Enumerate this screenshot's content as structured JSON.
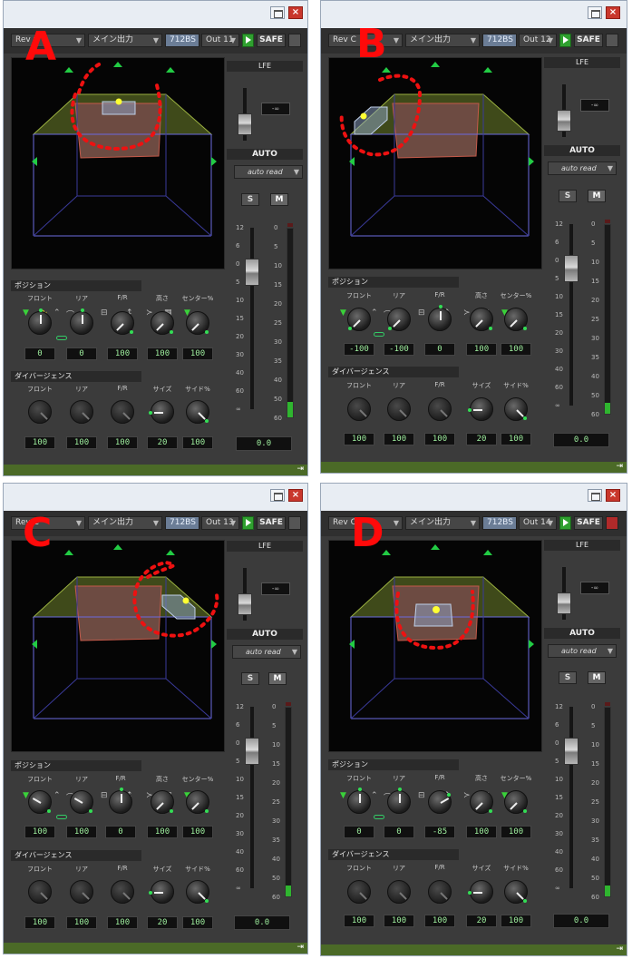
{
  "colors": {
    "accent_red": "#ff0a0a",
    "panel_bg": "#3b3b3b",
    "value_green": "#9ff09f"
  },
  "panels": [
    {
      "letter": "A",
      "src": "Rev C",
      "main": "メイン出力",
      "fmt": "712BS",
      "out": "Out 11",
      "safe": "SAFE",
      "lfe": "LFE",
      "lfe_val": "-∞",
      "auto": "AUTO",
      "auto_mode": "auto read",
      "s": "S",
      "m": "M",
      "pos_title": "ポジション",
      "div_title": "ダイバージェンス",
      "pos_labels": [
        "フロント",
        "リア",
        "F/R",
        "高さ",
        "センター%"
      ],
      "pos_values": [
        "0",
        "0",
        "100",
        "100",
        "100"
      ],
      "div_labels": [
        "フロント",
        "リア",
        "F/R",
        "サイズ",
        "サイド%"
      ],
      "div_values": [
        "100",
        "100",
        "100",
        "20",
        "100"
      ],
      "out_value": "0.0"
    },
    {
      "letter": "B",
      "src": "Rev C",
      "main": "メイン出力",
      "fmt": "712BS",
      "out": "Out 12",
      "safe": "SAFE",
      "lfe": "LFE",
      "lfe_val": "-∞",
      "auto": "AUTO",
      "auto_mode": "auto read",
      "s": "S",
      "m": "M",
      "pos_title": "ポジション",
      "div_title": "ダイバージェンス",
      "pos_labels": [
        "フロント",
        "リア",
        "F/R",
        "高さ",
        "センター%"
      ],
      "pos_values": [
        "-100",
        "-100",
        "0",
        "100",
        "100"
      ],
      "div_labels": [
        "フロント",
        "リア",
        "F/R",
        "サイズ",
        "サイド%"
      ],
      "div_values": [
        "100",
        "100",
        "100",
        "20",
        "100"
      ],
      "out_value": "0.0"
    },
    {
      "letter": "C",
      "src": "Rev C",
      "main": "メイン出力",
      "fmt": "712BS",
      "out": "Out 13",
      "safe": "SAFE",
      "lfe": "LFE",
      "lfe_val": "-∞",
      "auto": "AUTO",
      "auto_mode": "auto read",
      "s": "S",
      "m": "M",
      "pos_title": "ポジション",
      "div_title": "ダイバージェンス",
      "pos_labels": [
        "フロント",
        "リア",
        "F/R",
        "高さ",
        "センター%"
      ],
      "pos_values": [
        "100",
        "100",
        "0",
        "100",
        "100"
      ],
      "div_labels": [
        "フロント",
        "リア",
        "F/R",
        "サイズ",
        "サイド%"
      ],
      "div_values": [
        "100",
        "100",
        "100",
        "20",
        "100"
      ],
      "out_value": "0.0"
    },
    {
      "letter": "D",
      "src": "Rev C",
      "main": "メイン出力",
      "fmt": "712BS",
      "out": "Out 14",
      "safe": "SAFE",
      "lfe": "LFE",
      "lfe_val": "-∞",
      "auto": "AUTO",
      "auto_mode": "auto read",
      "s": "S",
      "m": "M",
      "pos_title": "ポジション",
      "div_title": "ダイバージェンス",
      "pos_labels": [
        "フロント",
        "リア",
        "F/R",
        "高さ",
        "センター%"
      ],
      "pos_values": [
        "0",
        "0",
        "-85",
        "100",
        "100"
      ],
      "div_labels": [
        "フロント",
        "リア",
        "F/R",
        "サイズ",
        "サイド%"
      ],
      "div_values": [
        "100",
        "100",
        "100",
        "20",
        "100"
      ],
      "out_value": "0.0"
    }
  ],
  "fader_scale": [
    "12",
    "6",
    "0",
    "5",
    "10",
    "15",
    "20",
    "30",
    "40",
    "60",
    "∞"
  ],
  "meter_scale": [
    "0",
    "5",
    "10",
    "15",
    "20",
    "25",
    "30",
    "35",
    "40",
    "50",
    "60"
  ]
}
